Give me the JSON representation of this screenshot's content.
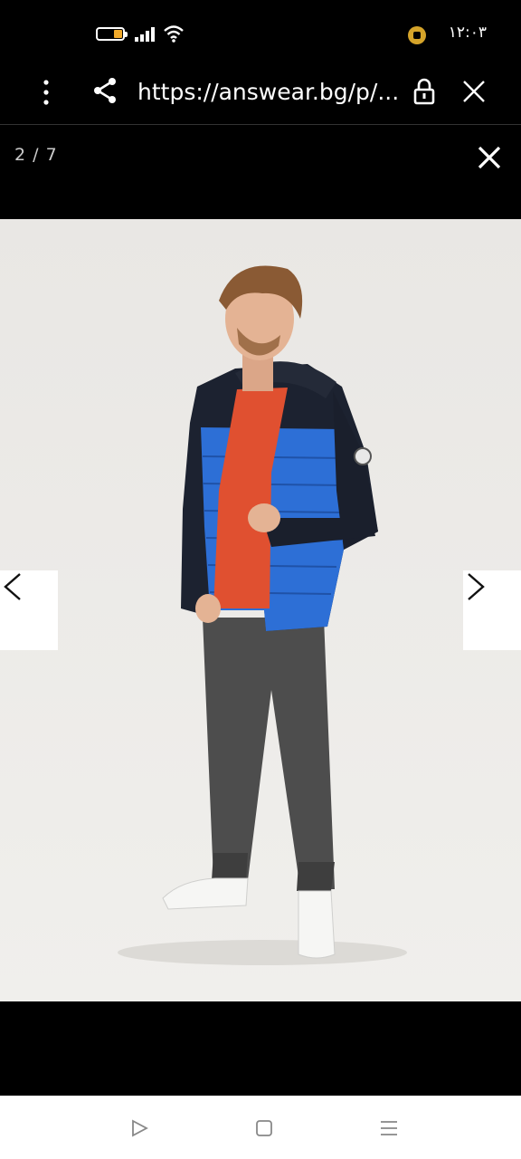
{
  "status_bar": {
    "time": "۱۲:۰۳",
    "icons": [
      "battery-icon",
      "signal-icon",
      "wifi-icon",
      "notification-icon"
    ],
    "battery_color": "#f0a92a"
  },
  "browser": {
    "url": "https://answear.bg/p/...",
    "icons": [
      "menu-dots-icon",
      "share-icon",
      "lock-icon",
      "close-icon"
    ]
  },
  "gallery": {
    "counter": "2 / 7",
    "image": "man-wearing-blue-black-puffer-jacket",
    "prev_icon": "chevron-left-icon",
    "next_icon": "chevron-right-icon"
  },
  "system_nav": {
    "icons": [
      "back-triangle-icon",
      "home-square-icon",
      "recents-menu-icon"
    ]
  }
}
